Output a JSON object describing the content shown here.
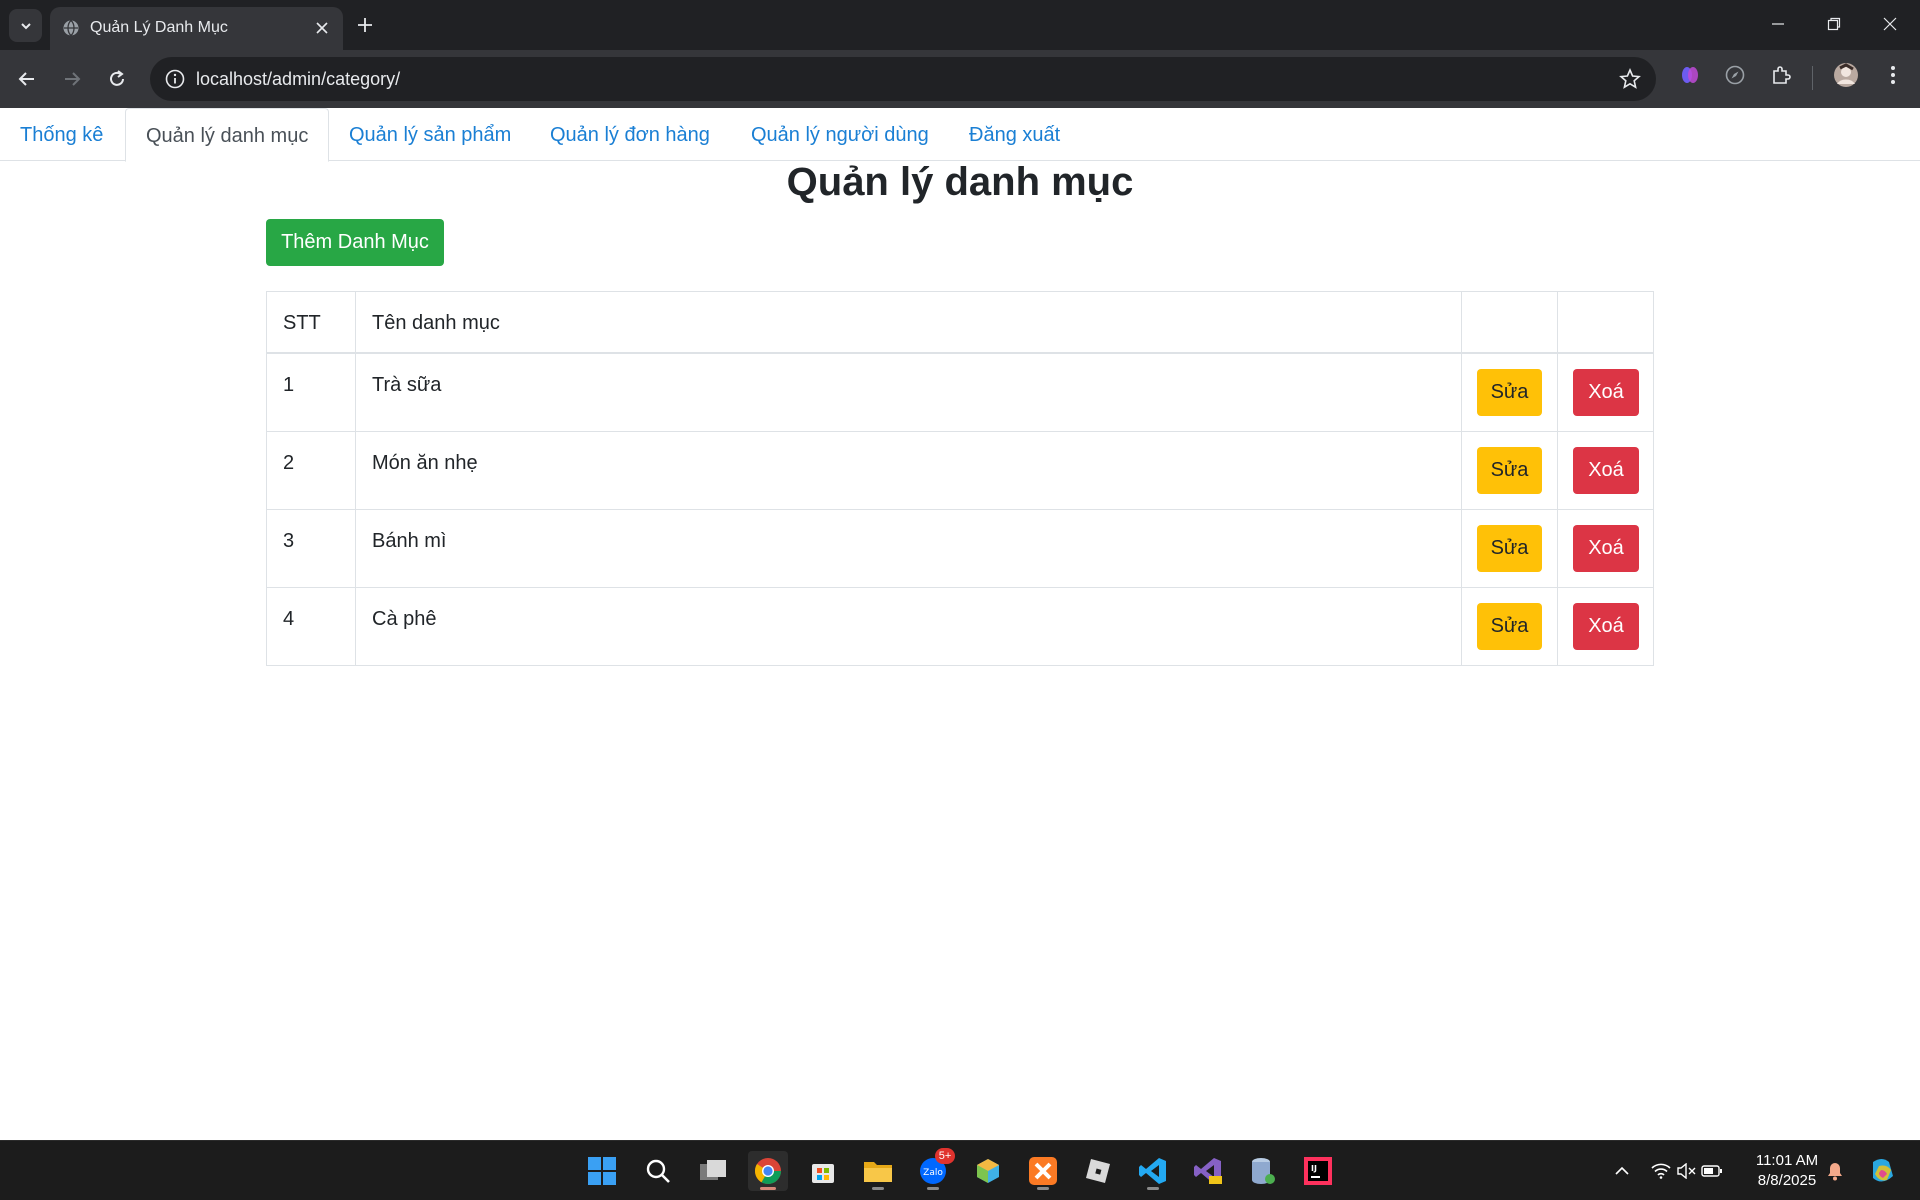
{
  "browser": {
    "tab_title": "Quản Lý Danh Mục",
    "url": "localhost/admin/category/"
  },
  "nav": {
    "tabs": [
      {
        "label": "Thống kê",
        "active": false
      },
      {
        "label": "Quản lý danh mục",
        "active": true
      },
      {
        "label": "Quản lý sản phẩm",
        "active": false
      },
      {
        "label": "Quản lý đơn hàng",
        "active": false
      },
      {
        "label": "Quản lý người dùng",
        "active": false
      },
      {
        "label": "Đăng xuất",
        "active": false
      }
    ]
  },
  "main": {
    "title": "Quản lý danh mục",
    "add_button": "Thêm Danh Mục",
    "table": {
      "headers": [
        "STT",
        "Tên danh mục",
        "",
        ""
      ],
      "rows": [
        {
          "stt": "1",
          "name": "Trà sữa",
          "edit": "Sửa",
          "delete": "Xoá"
        },
        {
          "stt": "2",
          "name": "Món ăn nhẹ",
          "edit": "Sửa",
          "delete": "Xoá"
        },
        {
          "stt": "3",
          "name": "Bánh mì",
          "edit": "Sửa",
          "delete": "Xoá"
        },
        {
          "stt": "4",
          "name": "Cà phê",
          "edit": "Sửa",
          "delete": "Xoá"
        }
      ]
    }
  },
  "taskbar": {
    "zalo_badge": "5+",
    "time": "11:01 AM",
    "date": "8/8/2025",
    "apps": [
      "start-icon",
      "search-icon",
      "task-view-icon",
      "chrome-icon",
      "store-icon",
      "file-explorer-icon",
      "zalo-icon",
      "box-app-icon",
      "xampp-icon",
      "roblox-icon",
      "vscode-icon",
      "visual-studio-icon",
      "db-icon",
      "intellij-icon"
    ]
  },
  "colors": {
    "success": "#28a745",
    "warning": "#ffc107",
    "danger": "#dc3545",
    "link": "#1a7fd4"
  }
}
